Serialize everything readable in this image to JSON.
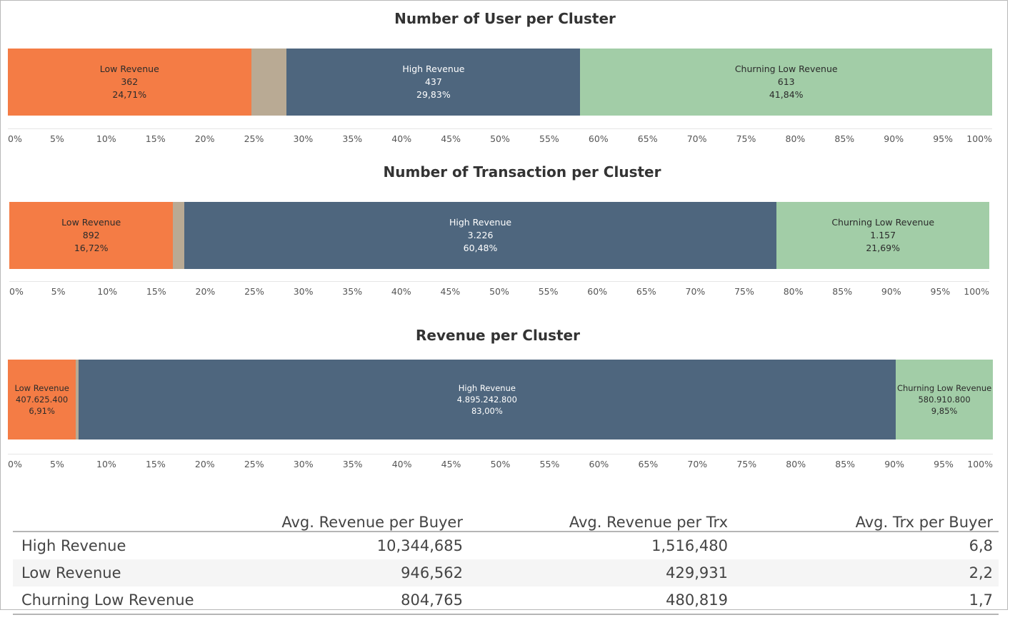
{
  "colors": {
    "low_revenue": "#f47c45",
    "other": "#b9aa94",
    "high_revenue": "#4e667e",
    "churning_low_revenue": "#a2cda7"
  },
  "chart_data": [
    {
      "type": "bar",
      "orientation": "horizontal-stacked-100",
      "title": "Number of User per Cluster",
      "x_ticks": [
        "0%",
        "5%",
        "10%",
        "15%",
        "20%",
        "25%",
        "30%",
        "35%",
        "40%",
        "45%",
        "50%",
        "55%",
        "60%",
        "65%",
        "70%",
        "75%",
        "80%",
        "85%",
        "90%",
        "95%",
        "100%"
      ],
      "xlim": [
        0,
        100
      ],
      "segments": [
        {
          "name": "Low Revenue",
          "value_label": "362",
          "pct_label": "24,71%",
          "share": 24.71,
          "labeled": true,
          "color_key": "low_revenue"
        },
        {
          "name": "",
          "value_label": "",
          "pct_label": "",
          "share": 3.62,
          "labeled": false,
          "color_key": "other"
        },
        {
          "name": "High Revenue",
          "value_label": "437",
          "pct_label": "29,83%",
          "share": 29.83,
          "labeled": true,
          "color_key": "high_revenue"
        },
        {
          "name": "Churning Low Revenue",
          "value_label": "613",
          "pct_label": "41,84%",
          "share": 41.84,
          "labeled": true,
          "color_key": "churning_low_revenue"
        }
      ]
    },
    {
      "type": "bar",
      "orientation": "horizontal-stacked-100",
      "title": "Number of Transaction per Cluster",
      "x_ticks": [
        "0%",
        "5%",
        "10%",
        "15%",
        "20%",
        "25%",
        "30%",
        "35%",
        "40%",
        "45%",
        "50%",
        "55%",
        "60%",
        "65%",
        "70%",
        "75%",
        "80%",
        "85%",
        "90%",
        "95%",
        "100%"
      ],
      "xlim": [
        0,
        100
      ],
      "segments": [
        {
          "name": "Low Revenue",
          "value_label": "892",
          "pct_label": "16,72%",
          "share": 16.72,
          "labeled": true,
          "color_key": "low_revenue"
        },
        {
          "name": "",
          "value_label": "",
          "pct_label": "",
          "share": 1.11,
          "labeled": false,
          "color_key": "other"
        },
        {
          "name": "High Revenue",
          "value_label": "3.226",
          "pct_label": "60,48%",
          "share": 60.48,
          "labeled": true,
          "color_key": "high_revenue"
        },
        {
          "name": "Churning Low Revenue",
          "value_label": "1.157",
          "pct_label": "21,69%",
          "share": 21.69,
          "labeled": true,
          "color_key": "churning_low_revenue"
        }
      ]
    },
    {
      "type": "bar",
      "orientation": "horizontal-stacked-100",
      "title": "Revenue per Cluster",
      "x_ticks": [
        "0%",
        "5%",
        "10%",
        "15%",
        "20%",
        "25%",
        "30%",
        "35%",
        "40%",
        "45%",
        "50%",
        "55%",
        "60%",
        "65%",
        "70%",
        "75%",
        "80%",
        "85%",
        "90%",
        "95%",
        "100%"
      ],
      "xlim": [
        0,
        100
      ],
      "segments": [
        {
          "name": "Low Revenue",
          "value_label": "407.625.400",
          "pct_label": "6,91%",
          "share": 6.91,
          "labeled": true,
          "color_key": "low_revenue"
        },
        {
          "name": "",
          "value_label": "",
          "pct_label": "",
          "share": 0.24,
          "labeled": false,
          "color_key": "other"
        },
        {
          "name": "High Revenue",
          "value_label": "4.895.242.800",
          "pct_label": "83,00%",
          "share": 83.0,
          "labeled": true,
          "color_key": "high_revenue"
        },
        {
          "name": "Churning Low Revenue",
          "value_label": "580.910.800",
          "pct_label": "9,85%",
          "share": 9.85,
          "labeled": true,
          "color_key": "churning_low_revenue"
        }
      ]
    }
  ],
  "table": {
    "headers": [
      "",
      "Avg. Revenue per Buyer",
      "Avg. Revenue per Trx",
      "Avg. Trx per Buyer"
    ],
    "rows": [
      {
        "name": "High Revenue",
        "avg_rev_buyer": "10,344,685",
        "avg_rev_trx": "1,516,480",
        "avg_trx_buyer": "6,8"
      },
      {
        "name": "Low Revenue",
        "avg_rev_buyer": "946,562",
        "avg_rev_trx": "429,931",
        "avg_trx_buyer": "2,2"
      },
      {
        "name": "Churning Low Revenue",
        "avg_rev_buyer": "804,765",
        "avg_rev_trx": "480,819",
        "avg_trx_buyer": "1,7"
      }
    ]
  }
}
